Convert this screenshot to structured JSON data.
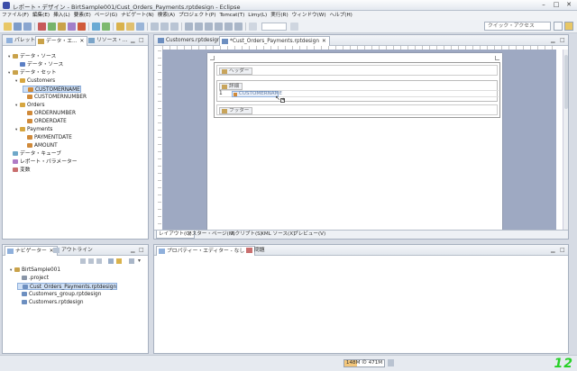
{
  "window": {
    "title": "レポート・デザイン - BirtSample001/Cust_Orders_Payments.rptdesign - Eclipse"
  },
  "menu": [
    "ファイル(F)",
    "編集(E)",
    "挿入(L)",
    "要素(E)",
    "ページ(G)",
    "ナビゲート(N)",
    "検索(A)",
    "プロジェクト(P)",
    "Tomcat(T)",
    "Limy(L)",
    "実行(R)",
    "ウィンドウ(W)",
    "ヘルプ(H)"
  ],
  "toolbar": {
    "quick_access_placeholder": "クイック・アクセス"
  },
  "left_panel": {
    "tabs": [
      "パレット",
      "データ・エ...",
      "リソース・..."
    ],
    "tree": [
      {
        "label": "データ・ソース",
        "level": 0,
        "twisty": "▾",
        "color": "#c9a24a"
      },
      {
        "label": "データ・ソース",
        "level": 1,
        "twisty": "",
        "color": "#5b7fc4"
      },
      {
        "label": "データ・セット",
        "level": 0,
        "twisty": "▾",
        "color": "#c9a24a"
      },
      {
        "label": "Customers",
        "level": 1,
        "twisty": "▾",
        "color": "#d6a640"
      },
      {
        "label": "CUSTOMERNAME",
        "level": 2,
        "twisty": "",
        "color": "#d08a3a",
        "selected": true
      },
      {
        "label": "CUSTOMERNUMBER",
        "level": 2,
        "twisty": "",
        "color": "#d08a3a"
      },
      {
        "label": "Orders",
        "level": 1,
        "twisty": "▾",
        "color": "#d6a640"
      },
      {
        "label": "ORDERNUMBER",
        "level": 2,
        "twisty": "",
        "color": "#d08a3a"
      },
      {
        "label": "ORDERDATE",
        "level": 2,
        "twisty": "",
        "color": "#d08a3a"
      },
      {
        "label": "Payments",
        "level": 1,
        "twisty": "▾",
        "color": "#d6a640"
      },
      {
        "label": "PAYMENTDATE",
        "level": 2,
        "twisty": "",
        "color": "#d08a3a"
      },
      {
        "label": "AMOUNT",
        "level": 2,
        "twisty": "",
        "color": "#d08a3a"
      },
      {
        "label": "データ・キューブ",
        "level": 0,
        "twisty": "",
        "color": "#6fa8c9"
      },
      {
        "label": "レポート・パラメーター",
        "level": 0,
        "twisty": "",
        "color": "#b07cc6"
      },
      {
        "label": "変数",
        "level": 0,
        "twisty": "",
        "color": "#c96f6f"
      }
    ]
  },
  "editor": {
    "tabs": [
      "Customers.rptdesign",
      "*Cust_Orders_Payments.rptdesign"
    ],
    "bands": {
      "header": "ヘッダー",
      "detail": "詳細",
      "footer": "フッター"
    },
    "cell_field": "CUSTOMERNAME",
    "row_number": "1",
    "bottom_tabs": [
      "レイアウト(Q)",
      "マスター・ページ(M)",
      "スクリプト(S)",
      "XML ソース(X)",
      "プレビュー(V)"
    ]
  },
  "navigator": {
    "tabs": [
      "ナビゲーター",
      "アウトライン"
    ],
    "tree": [
      {
        "label": "BirtSample001",
        "level": 0,
        "twisty": "▾",
        "color": "#c9a24a"
      },
      {
        "label": ".project",
        "level": 1,
        "twisty": "",
        "color": "#8a96a8"
      },
      {
        "label": "Cust_Orders_Payments.rptdesign",
        "level": 1,
        "twisty": "",
        "color": "#6d8fc0",
        "selected": true
      },
      {
        "label": "Customers_group.rptdesign",
        "level": 1,
        "twisty": "",
        "color": "#6d8fc0"
      },
      {
        "label": "Customers.rptdesign",
        "level": 1,
        "twisty": "",
        "color": "#6d8fc0"
      }
    ]
  },
  "properties": {
    "tabs": [
      "プロパティー・エディター - なし",
      "問題"
    ]
  },
  "status": {
    "heap": "148M の 471M",
    "heap_fraction": 0.31,
    "corner_number": "12"
  }
}
